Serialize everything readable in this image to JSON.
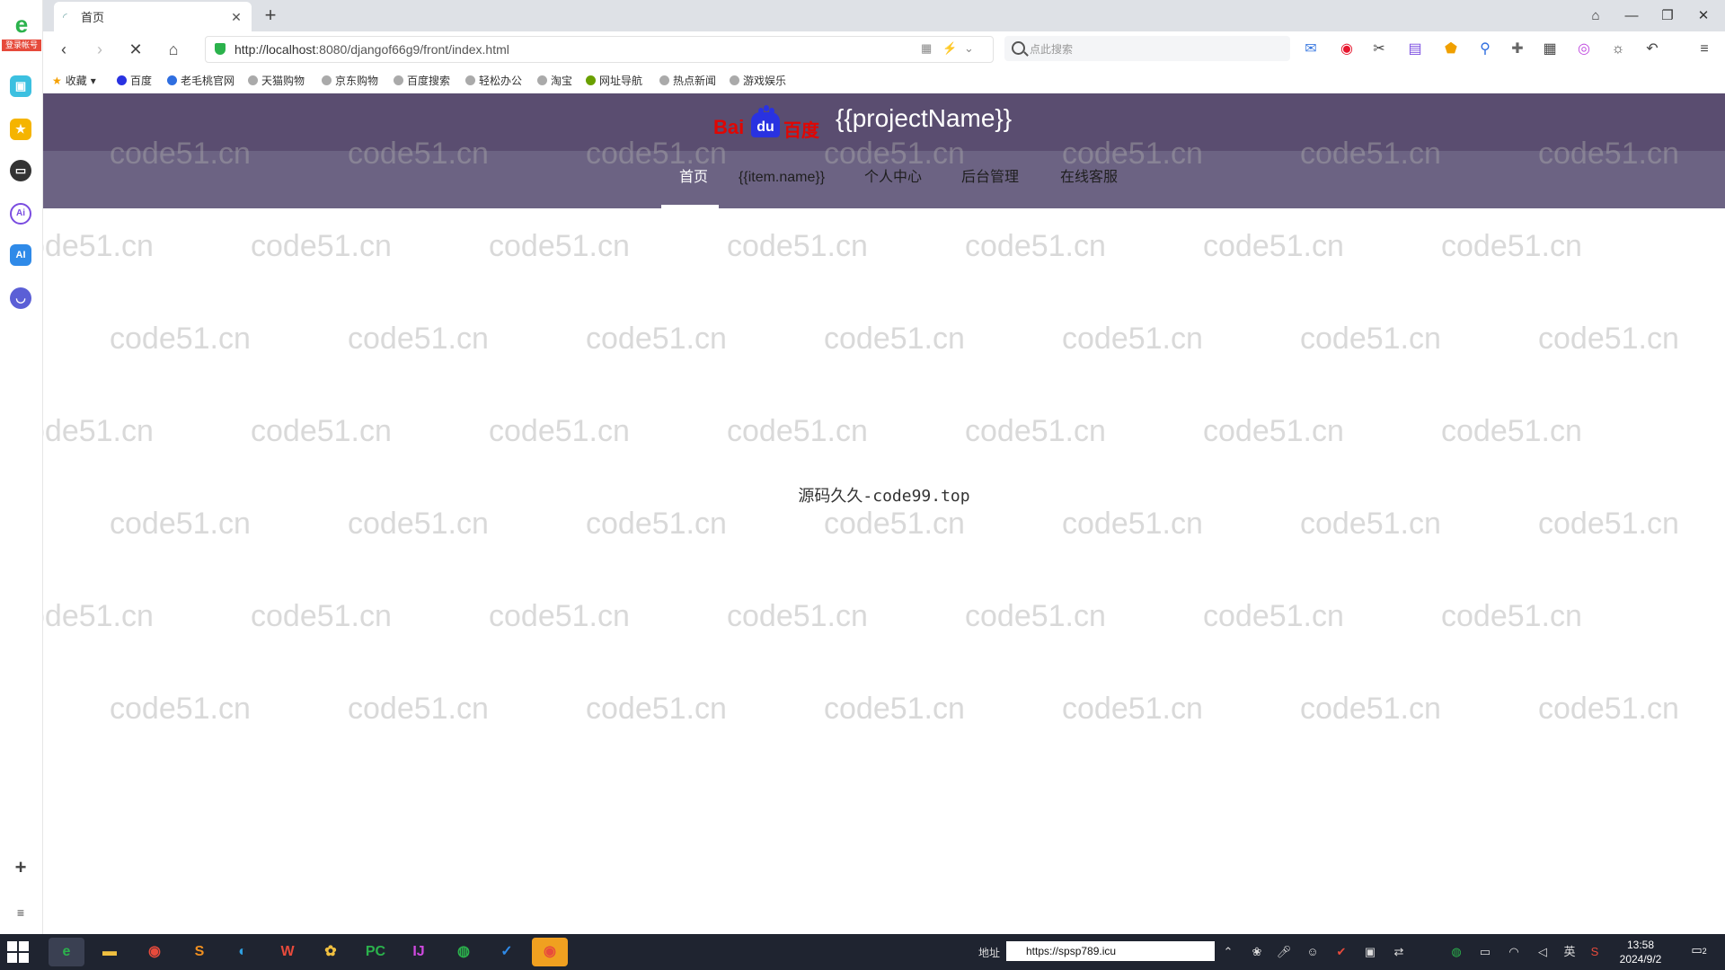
{
  "browser": {
    "tab_title": "首页",
    "url_host": "http://localhost",
    "url_rest": ":8080/djangof66g9/front/index.html",
    "search_placeholder": "点此搜索",
    "bookmarks": [
      "收藏",
      "百度",
      "老毛桃官网",
      "天猫购物",
      "京东购物",
      "百度搜索",
      "轻松办公",
      "淘宝",
      "网址导航",
      "热点新闻",
      "游戏娱乐"
    ]
  },
  "sidebar": {
    "login_label": "登录帐号",
    "icons": [
      "chat-icon",
      "star-icon",
      "game-icon",
      "ai-icon",
      "ai-assistant-icon",
      "robot-icon"
    ]
  },
  "site": {
    "logo_text_1": "Bai",
    "logo_text_2": "du",
    "logo_text_3": "百度",
    "project_name": "{{projectName}}",
    "menu": [
      "首页",
      "{{item.name}}",
      "个人中心",
      "后台管理",
      "在线客服"
    ],
    "center_text": "源码久久-code99.top",
    "watermark": "code51.cn"
  },
  "taskbar": {
    "address_label": "地址",
    "address_value": "https://spsp789.icu",
    "time": "13:58",
    "date": "2024/9/2",
    "ime": "英",
    "notification_count": "2"
  },
  "colors": {
    "header_bg": "#5a4d70",
    "menu_bg": "#6c6383",
    "accent_green": "#2bb24c"
  }
}
